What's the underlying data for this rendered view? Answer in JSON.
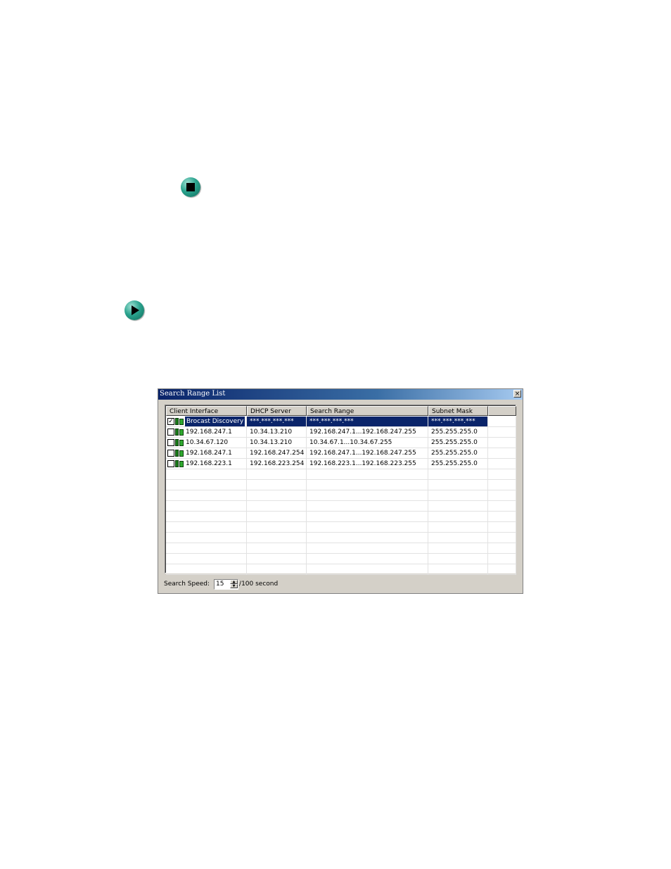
{
  "window": {
    "title": "Search Range List",
    "close_label": "×"
  },
  "columns": [
    "Client Interface",
    "DHCP Server",
    "Search Range",
    "Subnet Mask",
    ""
  ],
  "rows": [
    {
      "checked": true,
      "client": "Brocast Discovery",
      "dhcp": "***.***.***.***",
      "range": "***.***.***.***",
      "mask": "***.***.***.***",
      "selected": true
    },
    {
      "checked": false,
      "client": "192.168.247.1",
      "dhcp": "10.34.13.210",
      "range": "192.168.247.1...192.168.247.255",
      "mask": "255.255.255.0",
      "selected": false
    },
    {
      "checked": false,
      "client": "10.34.67.120",
      "dhcp": "10.34.13.210",
      "range": "10.34.67.1...10.34.67.255",
      "mask": "255.255.255.0",
      "selected": false
    },
    {
      "checked": false,
      "client": "192.168.247.1",
      "dhcp": "192.168.247.254",
      "range": "192.168.247.1...192.168.247.255",
      "mask": "255.255.255.0",
      "selected": false
    },
    {
      "checked": false,
      "client": "192.168.223.1",
      "dhcp": "192.168.223.254",
      "range": "192.168.223.1...192.168.223.255",
      "mask": "255.255.255.0",
      "selected": false
    }
  ],
  "footer": {
    "speed_label": "Search Speed:",
    "speed_value": "15",
    "unit": "/100 second"
  },
  "icons": {
    "stop_bullet": "stop-bullet-icon",
    "play_bullet": "play-bullet-icon",
    "network_adapter": "network-adapter-icon"
  },
  "colors": {
    "title_bar": "#0a246a",
    "selection": "#0a246a",
    "bullet": "#2aa38e"
  }
}
